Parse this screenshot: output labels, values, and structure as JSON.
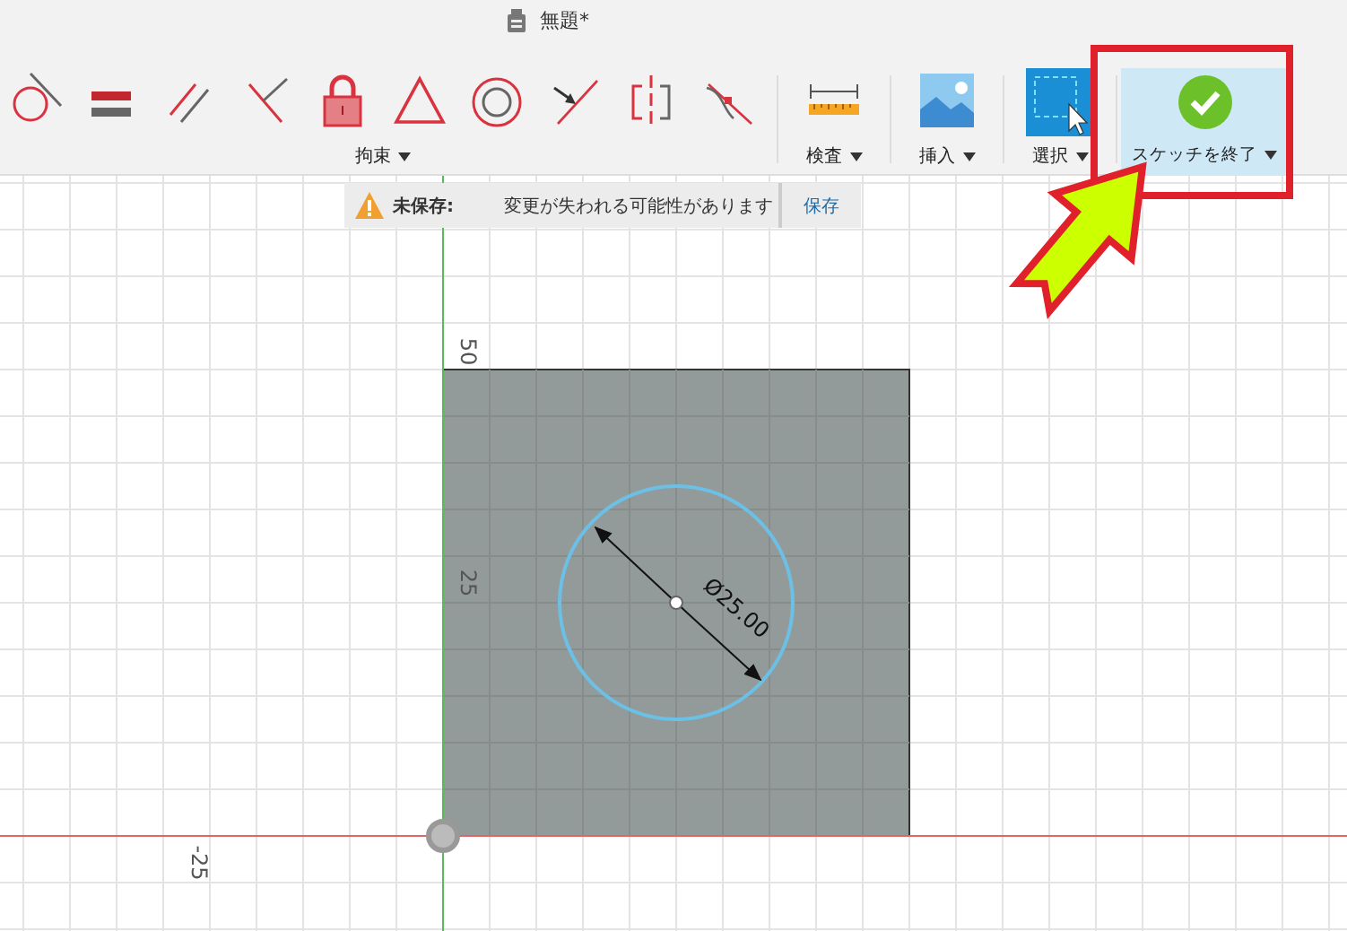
{
  "window": {
    "title": "無題*"
  },
  "toolbar": {
    "groups": [
      {
        "kind": "constraint",
        "label": "拘束"
      },
      {
        "kind": "inspect",
        "label": "検査"
      },
      {
        "kind": "insert",
        "label": "挿入"
      },
      {
        "kind": "select",
        "label": "選択"
      },
      {
        "kind": "finish",
        "label": "スケッチを終了"
      }
    ]
  },
  "warning": {
    "title": "未保存:",
    "message": "変更が失われる可能性があります",
    "action": "保存"
  },
  "canvas": {
    "axis_labels": [
      {
        "text": "50"
      },
      {
        "text": "25"
      },
      {
        "text": "-25"
      }
    ],
    "dimension": "Ø25.00"
  }
}
